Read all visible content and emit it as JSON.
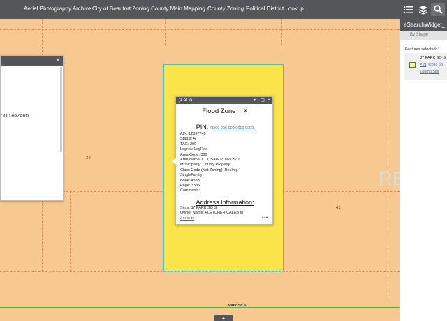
{
  "nav": {
    "links": [
      "Aerial Photography Archive",
      "City of Beaufort Zoning",
      "County Main Mapping",
      "County Zoning",
      "Political District Lookup"
    ]
  },
  "toolbar": {
    "list_icon": "list-icon",
    "layers_icon": "layers-icon",
    "search_icon": "search-icon"
  },
  "map": {
    "lot_left": "33",
    "lot_right": "41",
    "street": "Park Sq S",
    "watermark": "REside"
  },
  "left_panel": {
    "close": "×",
    "text": "OOD HAZARD"
  },
  "popup": {
    "count": "(1 of 2)",
    "controls": {
      "next": "►",
      "maximize": "☐",
      "close": "×"
    },
    "flood_label": "Flood Zone",
    "flood_value": " = X",
    "pin_label": "PIN:",
    "pin_value": "R200 006 000 0610 0000",
    "lines": [
      "AIN: 12397749",
      "Status: A",
      "TAG: 200",
      "Legres: LegRes",
      "Area Code: 330",
      "Area Name: COOSAW POINT S/D",
      "Municipality: County Property",
      "Class Code (Not Zoning): ResImp",
      "SingleFamily",
      "Book: 4333",
      "Page: 3335",
      "Comments:"
    ],
    "address_title": "Address Information:",
    "address_lines": [
      "Situs: 37 PARK SQ S",
      "Owner Name: FLETCHER CALEB M"
    ],
    "zoom_to": "Zoom to",
    "more": "•••"
  },
  "right_panel": {
    "title": "eSearchWidget_",
    "tab": "By Shape",
    "features_selected": "Features selected: 1",
    "result_address": "37 PARK SQ S",
    "result_pin_label": "PIN",
    "result_pin_value": ": R200 00",
    "result_link": "Zoning Site"
  },
  "bottom": {
    "handle": "▲"
  },
  "colors": {
    "parcel_fill": "#fbe34a",
    "parcel_outline": "#3fc5c0",
    "map_background": "#f7c990",
    "header": "#555659",
    "link": "#3b6fb8",
    "street_line": "#5cae3a"
  }
}
